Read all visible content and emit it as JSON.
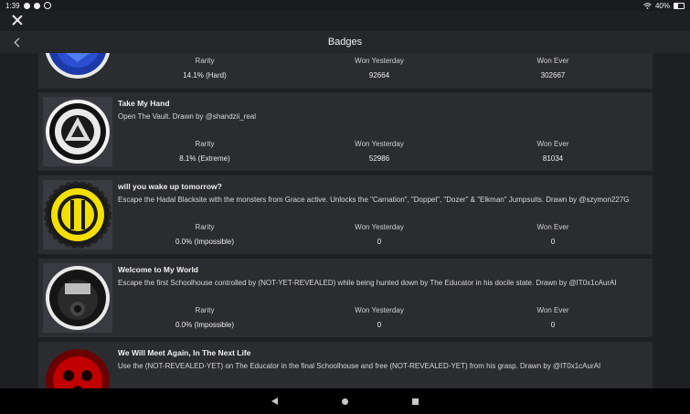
{
  "status_bar": {
    "time": "1:39",
    "battery": "40%"
  },
  "header": {
    "title": "Badges"
  },
  "columns": {
    "rarity": "Rarity",
    "won_yesterday": "Won Yesterday",
    "won_ever": "Won Ever"
  },
  "badges": [
    {
      "title": "",
      "description": "",
      "rarity": "14.1% (Hard)",
      "won_yesterday": "92664",
      "won_ever": "302667",
      "icon": "blue-grid-badge-icon"
    },
    {
      "title": "Take My Hand",
      "description": "Open The Vault. Drawn by @shandzii_real",
      "rarity": "8.1% (Extreme)",
      "won_yesterday": "52986",
      "won_ever": "81034",
      "icon": "vault-badge-icon"
    },
    {
      "title": "will you wake up tomorrow?",
      "description": "Escape the Hadal Blacksite with the monsters from Grace active. Unlocks the \"Carnation\", \"Doppel\", \"Dozer\" & \"Elkman\" Jumpsuits. Drawn by @szymon227G",
      "rarity": "0.0% (Impossible)",
      "won_yesterday": "0",
      "won_ever": "0",
      "icon": "yellow-gear-badge-icon"
    },
    {
      "title": "Welcome to My World",
      "description": "Escape the first Schoolhouse controlled by (NOT-YET-REVEALED) while being hunted down by The Educator in his docile state. Drawn by @IT0x1cAurAI",
      "rarity": "0.0% (Impossible)",
      "won_yesterday": "0",
      "won_ever": "0",
      "icon": "gas-mask-badge-icon"
    },
    {
      "title": "We Will Meet Again, In The Next Life",
      "description": "Use the (NOT-REVEALED-YET) on The Educator in the final Schoolhouse and free (NOT-REVEALED-YET) from his grasp. Drawn by @IT0x1cAurAI",
      "rarity": "",
      "won_yesterday": "",
      "won_ever": "",
      "icon": "red-face-badge-icon"
    }
  ]
}
